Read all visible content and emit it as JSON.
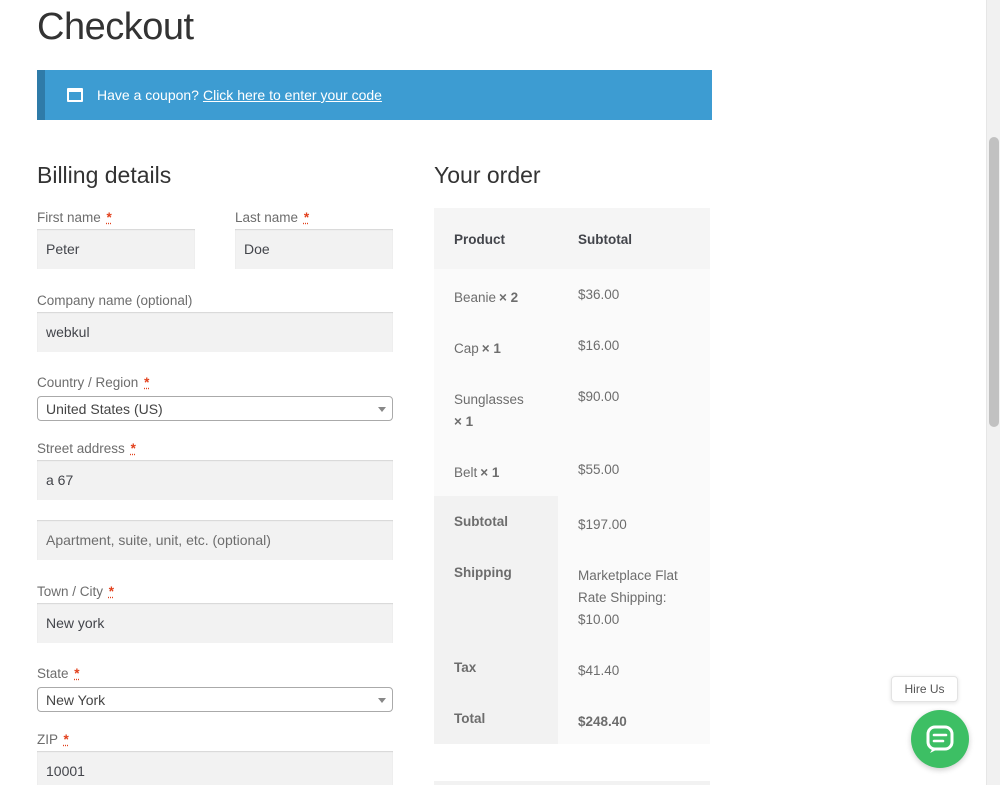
{
  "page": {
    "title": "Checkout"
  },
  "coupon": {
    "prompt": "Have a coupon?",
    "link": "Click here to enter your code"
  },
  "billing": {
    "heading": "Billing details",
    "required_mark": "*",
    "first_name": {
      "label": "First name",
      "value": "Peter"
    },
    "last_name": {
      "label": "Last name",
      "value": "Doe"
    },
    "company": {
      "label": "Company name (optional)",
      "value": "webkul"
    },
    "country": {
      "label": "Country / Region",
      "value": "United States (US)"
    },
    "street": {
      "label": "Street address",
      "value": "a 67",
      "apt_placeholder": "Apartment, suite, unit, etc. (optional)"
    },
    "city": {
      "label": "Town / City",
      "value": "New york"
    },
    "state": {
      "label": "State",
      "value": "New York"
    },
    "zip": {
      "label": "ZIP",
      "value": "10001"
    }
  },
  "order": {
    "heading": "Your order",
    "col_product": "Product",
    "col_subtotal": "Subtotal",
    "items": [
      {
        "name": "Beanie",
        "qty": "× 2",
        "price": "$36.00"
      },
      {
        "name": "Cap",
        "qty": "× 1",
        "price": "$16.00"
      },
      {
        "name": "Sunglasses",
        "qty": "× 1",
        "price": "$90.00"
      },
      {
        "name": "Belt",
        "qty": "× 1",
        "price": "$55.00"
      }
    ],
    "subtotal_label": "Subtotal",
    "subtotal_value": "$197.00",
    "shipping_label": "Shipping",
    "shipping_value": "Marketplace Flat Rate Shipping: $10.00",
    "tax_label": "Tax",
    "tax_value": "$41.40",
    "total_label": "Total",
    "total_value": "$248.40"
  },
  "widget": {
    "hire_label": "Hire Us"
  },
  "colors": {
    "banner": "#3d9cd2",
    "required": "#e2401c",
    "chat": "#3dbf64"
  }
}
